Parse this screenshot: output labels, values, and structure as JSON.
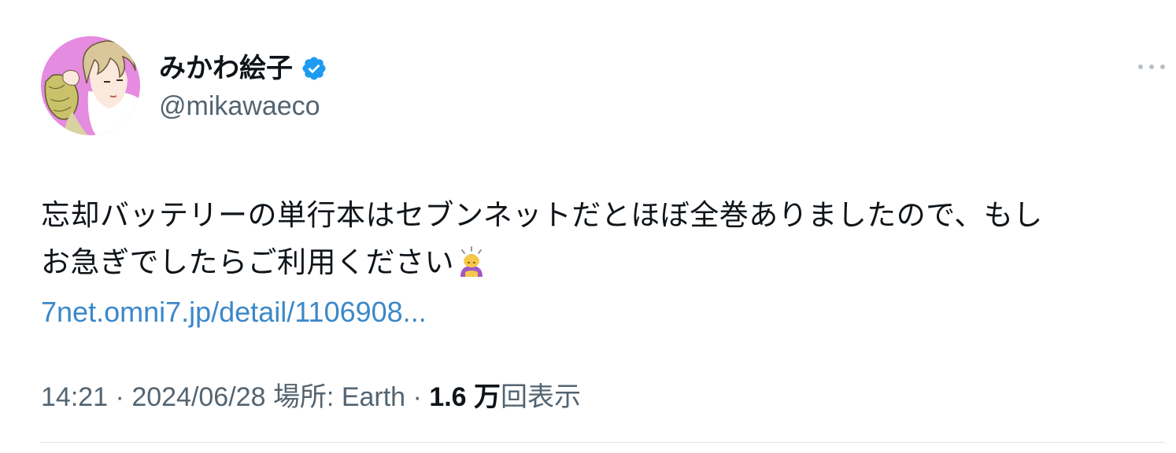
{
  "author": {
    "display_name": "みかわ絵子",
    "handle": "@mikawaeco",
    "verified": true,
    "avatar_icon": "avatar-illustration-icon"
  },
  "tweet": {
    "text_lines": [
      "忘却バッテリーの単行本はセブンネットだとほぼ全巻ありましたので、もし",
      "お急ぎでしたらご利用ください"
    ],
    "emoji": "bowing-person-emoji",
    "link_text": "7net.omni7.jp/detail/1106908..."
  },
  "meta": {
    "time": "14:21",
    "sep1": " · ",
    "date": "2024/06/28",
    "location_label": "場所: Earth",
    "sep2": " · ",
    "views_count": "1.6 万",
    "views_label": "回表示"
  },
  "colors": {
    "link": "#3b88c9",
    "secondary_text": "#536471",
    "verified_badge": "#1d9bf0"
  }
}
